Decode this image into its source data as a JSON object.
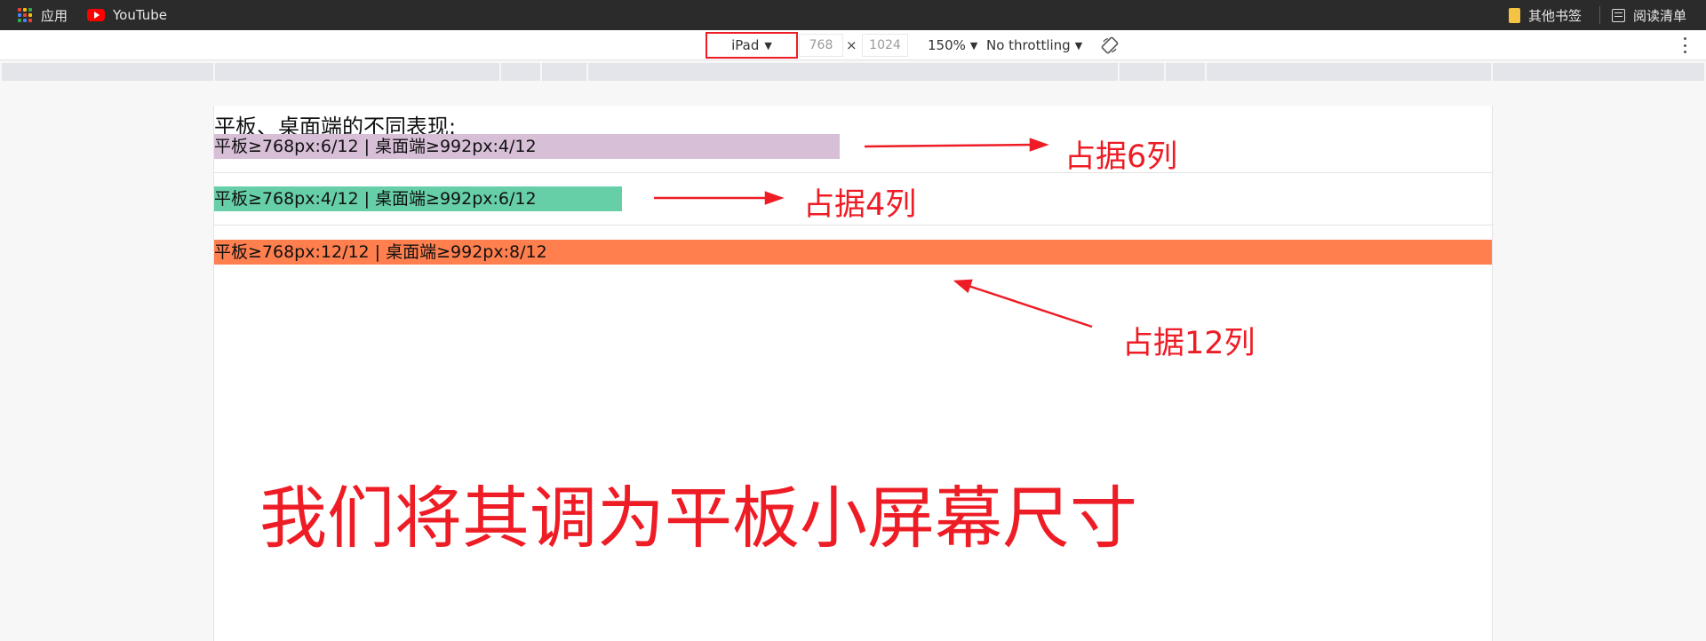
{
  "bookmarks": {
    "apps_label": "应用",
    "youtube_label": "YouTube",
    "other_bookmarks_label": "其他书签",
    "reading_list_label": "阅读清单"
  },
  "device_toolbar": {
    "device": "iPad",
    "width": "768",
    "height": "1024",
    "times_symbol": "×",
    "zoom": "150%",
    "throttling": "No throttling"
  },
  "page": {
    "title": "平板、桌面端的不同表现:",
    "columns": [
      {
        "text": "平板≥768px:6/12 | 桌面端≥992px:4/12",
        "span": 6,
        "color": "#d7bfd7"
      },
      {
        "text": "平板≥768px:4/12 | 桌面端≥992px:6/12",
        "span": 4,
        "color": "#66cfa8"
      },
      {
        "text": "平板≥768px:12/12 | 桌面端≥992px:8/12",
        "span": 12,
        "color": "#ff7f4f"
      }
    ]
  },
  "annotations": {
    "label_6": "占据6列",
    "label_4": "占据4列",
    "label_12": "占据12列",
    "caption": "我们将其调为平板小屏幕尺寸",
    "color": "#ee1c25"
  }
}
